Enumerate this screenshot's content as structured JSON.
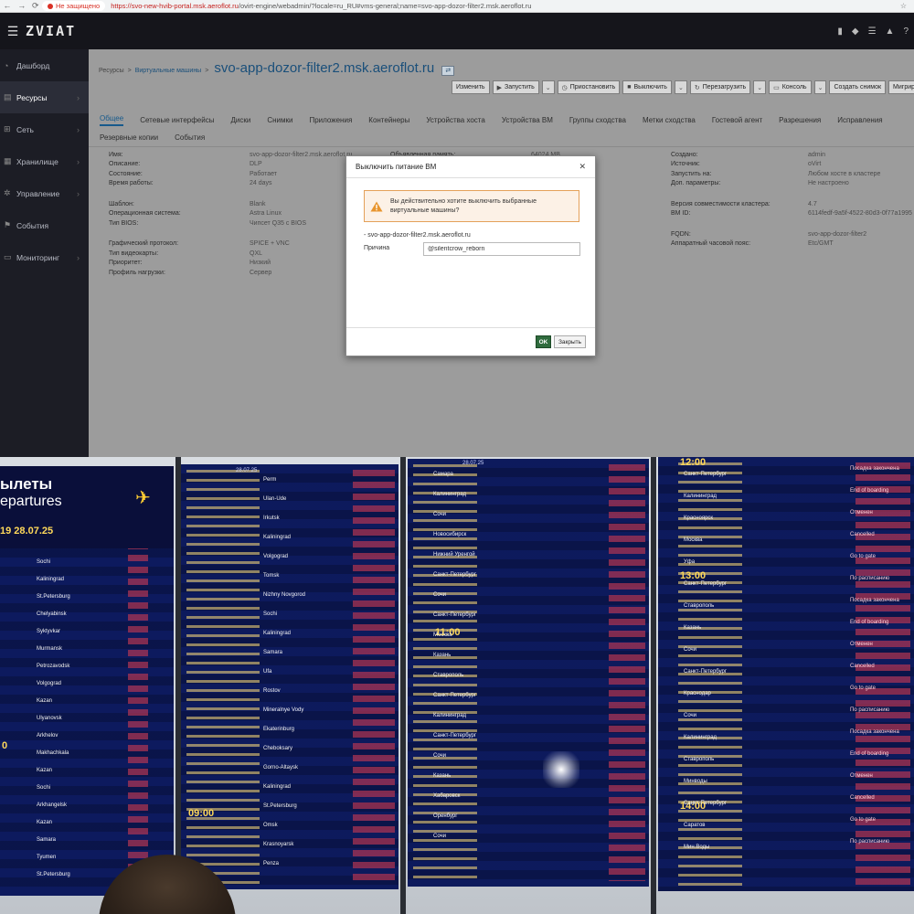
{
  "browser": {
    "insecure_label": "Не защищено",
    "url_host": "https://svo-new-hvib-portal.msk.aeroflot.ru",
    "url_path": "/ovirt-engine/webadmin/?locale=ru_RU#vms-general;name=svo-app-dozor-filter2.msk.aeroflot.ru"
  },
  "header": {
    "logo": "ZVIAT"
  },
  "sidebar": {
    "items": [
      {
        "label": "Дашборд"
      },
      {
        "label": "Ресурсы"
      },
      {
        "label": "Сеть"
      },
      {
        "label": "Хранилище"
      },
      {
        "label": "Управление"
      },
      {
        "label": "События"
      },
      {
        "label": "Мониторинг"
      }
    ]
  },
  "breadcrumb": {
    "root": "Ресурсы",
    "section": "Виртуальные машины",
    "vm_name": "svo-app-dozor-filter2.msk.aeroflot.ru"
  },
  "toolbar": {
    "edit": "Изменить",
    "start": "Запустить",
    "pause": "Приостановить",
    "shutdown": "Выключить",
    "reboot": "Перезагрузить",
    "console": "Консоль",
    "snapshot": "Создать снимок",
    "migrate": "Мигриров"
  },
  "tabs": {
    "row1": [
      "Общее",
      "Сетевые интерфейсы",
      "Диски",
      "Снимки",
      "Приложения",
      "Контейнеры",
      "Устройства хоста",
      "Устройства ВМ",
      "Группы сходства",
      "Метки сходства",
      "Гостевой агент",
      "Разрешения",
      "Исправления"
    ],
    "row2": [
      "Резервные копии",
      "События"
    ]
  },
  "details_left": [
    {
      "k": "Имя:",
      "v": "svo-app-dozor-filter2.msk.aeroflot.ru"
    },
    {
      "k": "Описание:",
      "v": "DLP"
    },
    {
      "k": "Состояние:",
      "v": "Работает"
    },
    {
      "k": "Время работы:",
      "v": "24 days"
    },
    {
      "k": "Шаблон:",
      "v": "Blank"
    },
    {
      "k": "Операционная система:",
      "v": "Astra Linux"
    },
    {
      "k": "Тип BIOS:",
      "v": "Чипсет Q35 с BIOS"
    },
    {
      "k": "Графический протокол:",
      "v": "SPICE + VNC"
    },
    {
      "k": "Тип видеокарты:",
      "v": "QXL"
    },
    {
      "k": "Приоритет:",
      "v": "Низкий"
    },
    {
      "k": "Профиль нагрузки:",
      "v": "Сервер"
    }
  ],
  "details_mid": [
    {
      "k": "Объявленная память:",
      "v": "64024 MB"
    }
  ],
  "details_right": [
    {
      "k": "Создано:",
      "v": "admin"
    },
    {
      "k": "Источник:",
      "v": "oVirt"
    },
    {
      "k": "Запустить на:",
      "v": "Любом хосте в кластере"
    },
    {
      "k": "Доп. параметры:",
      "v": "Не настроено"
    },
    {
      "k": "Версия совместимости кластера:",
      "v": "4.7"
    },
    {
      "k": "ВМ ID:",
      "v": "6114fedf-9a5f-4522-80d3-0f77a1995"
    },
    {
      "k": "FQDN:",
      "v": "svo-app-dozor-filter2"
    },
    {
      "k": "Аппаратный часовой пояс:",
      "v": "Etc/GMT"
    }
  ],
  "modal": {
    "title": "Выключить питание ВМ",
    "warning": "Вы действительно хотите выключить выбранные виртуальные машины?",
    "vm_item": "- svo-app-dozor-filter2.msk.aeroflot.ru",
    "reason_label": "Причина",
    "reason_value": "@silentcrow_reborn",
    "ok": "OK",
    "close": "Закрыть"
  },
  "departures": {
    "title_ru": "ылеты",
    "title_en": "epartures",
    "date": "19 28.07.25",
    "board2_date": "28.07.25",
    "board3_date": "28.07.25",
    "hours": [
      "11:00",
      "12:00",
      "13:00",
      "14:00",
      "09:00"
    ],
    "board1_cities": [
      "Sochi",
      "Kaliningrad",
      "St.Petersburg",
      "Chelyabinsk",
      "Syktyvkar",
      "Murmansk",
      "Petrozavodsk",
      "Volgograd",
      "Kazan",
      "Ulyanovsk",
      "Arkhelov",
      "Makhachkala",
      "Kazan",
      "Sochi",
      "Arkhangelsk",
      "Kazan",
      "Samara",
      "Tyumen",
      "St.Petersburg"
    ],
    "board2_cities": [
      "Perm",
      "Ulan-Ude",
      "Irkutsk",
      "Kaliningrad",
      "Volgograd",
      "Tomsk",
      "Nizhny Novgorod",
      "Sochi",
      "Kaliningrad",
      "Samara",
      "Ufa",
      "Rostov",
      "Mineralnye Vody",
      "Ekaterinburg",
      "Cheboksary",
      "Gorno-Altaysk",
      "Kaliningrad",
      "St.Petersburg",
      "Omsk",
      "Krasnoyarsk",
      "Penza"
    ],
    "board3_cities": [
      "Самара",
      "Калининград",
      "Сочи",
      "Новосибирск",
      "Нижний Уренгой",
      "Санкт-Петербург",
      "Сочи",
      "Санкт-Петербург",
      "Москва",
      "Казань",
      "Ставрополь",
      "Санкт-Петербург",
      "Калининград",
      "Санкт-Петербург",
      "Сочи",
      "Казань",
      "Хабаровск",
      "Оренбург",
      "Сочи"
    ],
    "board4_cities": [
      "Санкт-Петербург",
      "Калининград",
      "Красноярск",
      "Москва",
      "Уфа",
      "Санкт-Петербург",
      "Ставрополь",
      "Казань",
      "Сочи",
      "Санкт-Петербург",
      "Краснодар",
      "Сочи",
      "Калининград",
      "Ставрополь",
      "Минводы",
      "Санкт-Петербург",
      "Саратов",
      "Мин.Воды"
    ],
    "status_samples": [
      "Посадка закончена",
      "End of boarding",
      "Отменен",
      "Cancelled",
      "Go to gate",
      "По расписанию"
    ]
  },
  "colors": {
    "header_bg": "#15151b",
    "sidebar_bg": "#1c1d25",
    "content_overlay": "#9c9c9c",
    "link": "#1a4f7a",
    "ok_button": "#2f6b3d",
    "warn_border": "#e4a15a",
    "board_bg": "#0b1650",
    "board_time": "#ffd95a",
    "cancel_red": "#b23552"
  }
}
